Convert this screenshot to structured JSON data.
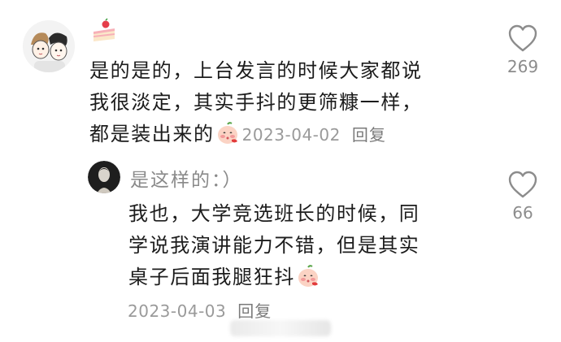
{
  "comment": {
    "text_line1": "是的是的，上台发言的时候大家都说",
    "text_line2": "我很淡定，其实手抖的更筛糠一样，",
    "text_line3": "都是装出来的",
    "date": "2023-04-02",
    "reply_label": "回复",
    "like_count": "269",
    "avatar_icon": "cartoon-couple-avatar",
    "badge_icon": "cake-sticker",
    "emoji_icon": "shy-peach-emoji"
  },
  "reply": {
    "author": "是这样的：）",
    "text_line1": "我也，大学竞选班长的时候，同",
    "text_line2": "学说我演讲能力不错，但是其实",
    "text_line3": "桌子后面我腿狂抖",
    "date": "2023-04-03",
    "reply_label": "回复",
    "like_count": "66",
    "avatar_icon": "dark-portrait-avatar",
    "emoji_icon": "shy-peach-emoji"
  },
  "colors": {
    "text": "#1c1c1c",
    "meta": "#9a9a9a",
    "icon": "#8c8c8c"
  }
}
